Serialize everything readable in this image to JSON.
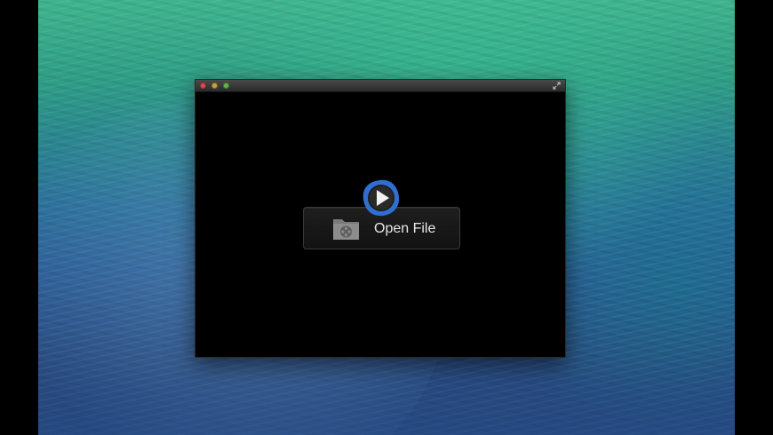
{
  "desktop": {
    "wallpaper": "ocean-wave"
  },
  "window": {
    "traffic_lights": [
      "close",
      "minimize",
      "zoom"
    ],
    "fullscreen_icon": "fullscreen-arrows-icon"
  },
  "player": {
    "logo_icon": "play-logo-icon",
    "open_button": {
      "icon": "film-folder-icon",
      "label": "Open File"
    }
  },
  "colors": {
    "accent_blue": "#2f6fd0",
    "light_close": "#d84c4c",
    "light_minimize": "#c9a23a",
    "light_zoom": "#6ab04c"
  }
}
